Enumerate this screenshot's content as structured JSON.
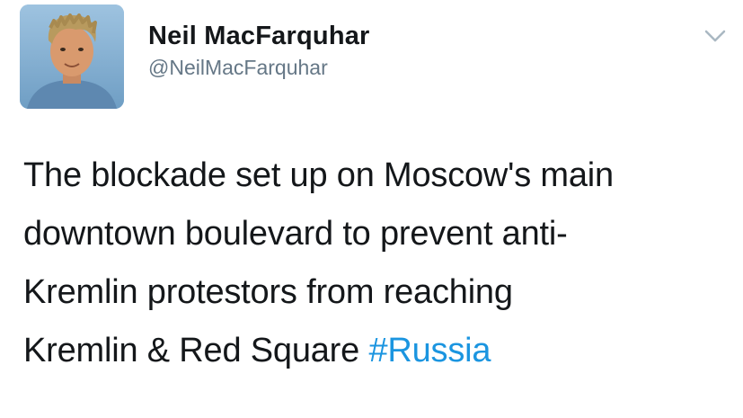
{
  "author": {
    "display_name": "Neil MacFarquhar",
    "username": "@NeilMacFarquhar",
    "avatar_icon": "profile-photo"
  },
  "tweet": {
    "text_line1": "The blockade set up on Moscow's main",
    "text_line2": "downtown boulevard to prevent anti-",
    "text_line3": "Kremlin protestors from reaching",
    "text_line4_prefix": "Kremlin & Red Square ",
    "hashtag": "#Russia"
  },
  "menu": {
    "icon": "chevron-down-icon"
  },
  "colors": {
    "text": "#14171a",
    "secondary": "#657786",
    "link": "#1b95e0",
    "chevron": "#aab8c2"
  }
}
